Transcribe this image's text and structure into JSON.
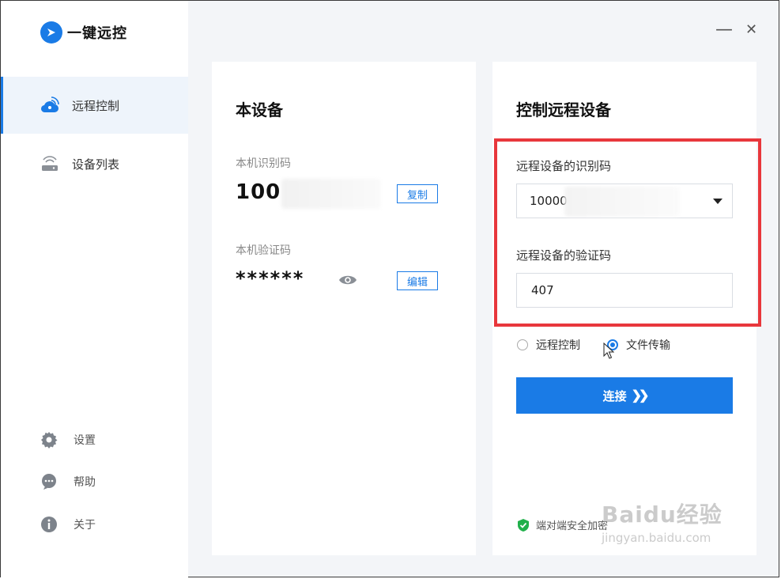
{
  "app": {
    "name": "一键远控"
  },
  "sidebar": {
    "items": [
      {
        "label": "远程控制",
        "icon": "cloud-remote-icon",
        "active": true
      },
      {
        "label": "设备列表",
        "icon": "router-icon",
        "active": false
      }
    ],
    "bottom": [
      {
        "label": "设置",
        "icon": "gear-icon"
      },
      {
        "label": "帮助",
        "icon": "help-chat-icon"
      },
      {
        "label": "关于",
        "icon": "info-icon"
      }
    ]
  },
  "window": {
    "minimize": "—",
    "close": "✕"
  },
  "local": {
    "title": "本设备",
    "id_label": "本机识别码",
    "id_value": "100",
    "copy_label": "复制",
    "code_label": "本机验证码",
    "code_value": "******",
    "edit_label": "编辑"
  },
  "remote": {
    "title": "控制远程设备",
    "id_label": "远程设备的识别码",
    "id_value": "10000",
    "code_label": "远程设备的验证码",
    "code_value": "407",
    "modes": [
      {
        "label": "远程控制",
        "checked": false
      },
      {
        "label": "文件传输",
        "checked": true
      }
    ],
    "connect_label": "连接",
    "security_text": "端对端安全加密"
  },
  "colors": {
    "accent": "#1a7be6",
    "highlight": "#e8373c"
  },
  "watermark": {
    "main": "Baidu经验",
    "sub": "jingyan.baidu.com"
  }
}
